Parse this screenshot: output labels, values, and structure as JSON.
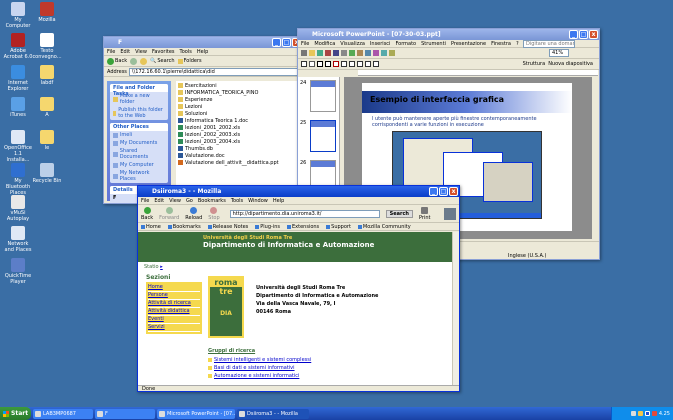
{
  "desktop": {
    "icons": [
      {
        "label": "My Computer",
        "color": "#c9d6f0"
      },
      {
        "label": "Mozilla",
        "color": "#c0392b"
      },
      {
        "label": "Adobe Acrobat 6.0",
        "color": "#b22222"
      },
      {
        "label": "Testo convegno...",
        "color": "#ffffff"
      },
      {
        "label": "Internet Explorer",
        "color": "#3b8de0"
      },
      {
        "label": "labdf",
        "color": "#f5d76e"
      },
      {
        "label": "iTunes",
        "color": "#5aa0e6"
      },
      {
        "label": "A",
        "color": "#f5d76e"
      },
      {
        "label": "OpenOffice 1.1 Installa...",
        "color": "#dfe8f5"
      },
      {
        "label": "le",
        "color": "#f5d76e"
      },
      {
        "label": "My Bluetooth Places",
        "color": "#2f6fd0"
      },
      {
        "label": "Recycle Bin",
        "color": "#bcd0e8"
      },
      {
        "label": "vMuSi Autoplay",
        "color": "#e8e8e8"
      },
      {
        "label": "Network and Places",
        "color": "#dfe8f5"
      },
      {
        "label": "QuickTime Player",
        "color": "#5c7ec8"
      }
    ]
  },
  "explorer": {
    "title": "F",
    "menu": [
      "File",
      "Edit",
      "View",
      "Favorites",
      "Tools",
      "Help"
    ],
    "toolbar": {
      "back": "Back",
      "search": "Search",
      "folders": "Folders"
    },
    "address_label": "Address",
    "address": "\\\\172.16.60.1\\pierre\\didattica\\did",
    "tasks": {
      "title": "File and Folder Tasks",
      "items": [
        "Make a new folder",
        "Publish this folder to the Web"
      ]
    },
    "places": {
      "title": "Other Places",
      "items": [
        "lmeli",
        "My Documents",
        "Shared Documents",
        "My Computer",
        "My Network Places"
      ]
    },
    "details": {
      "title": "Details",
      "name": "F",
      "type": "File Folder"
    },
    "files": [
      "Esercitazioni",
      "INFORMATICA_TEORICA_PINO",
      "Esperienze",
      "Lezioni",
      "Soluzioni",
      "Informatica Teorica 1.doc",
      "lezioni_2001_2002.xls",
      "lezioni_2002_2003.xls",
      "lezioni_2003_2004.xls",
      "Thumbs.db",
      "Valutazione.doc",
      "Valutazione dell_attivit__didattica.ppt"
    ]
  },
  "powerpoint": {
    "title": "Microsoft PowerPoint - [07-30-03.ppt]",
    "menu": [
      "File",
      "Modifica",
      "Visualizza",
      "Inserisci",
      "Formato",
      "Strumenti",
      "Presentazione",
      "Finestra",
      "?"
    ],
    "help_box": "Digitare una domanda",
    "zoom": "41%",
    "font_box": "Struttura",
    "layout_btn": "Nuova diapositiva",
    "slide_numbers": [
      "24",
      "25",
      "26",
      "27"
    ],
    "slide_title": "Esempio di interfaccia grafica",
    "slide_bullet": "l utente può mantenere aperte più finestre contemporaneamente corrispondenti a varie funzioni in esecuzione",
    "status": "Inglese (U.S.A.)"
  },
  "mozilla": {
    "title": "Dsiiroma3 - - Mozilla",
    "menu": [
      "File",
      "Edit",
      "View",
      "Go",
      "Bookmarks",
      "Tools",
      "Window",
      "Help"
    ],
    "nav": {
      "back": "Back",
      "forward": "Forward",
      "reload": "Reload",
      "stop": "Stop",
      "print": "Print",
      "search": "Search"
    },
    "url": "http://dipartimento.dia.uniroma3.it/",
    "personal_bar": [
      "Home",
      "Bookmarks",
      "Release Notes",
      "Plug-ins",
      "Extensions",
      "Support",
      "Mozilla Community"
    ],
    "site": {
      "university": "Università degli Studi Roma Tre",
      "department": "Dipartimento di Informatica e Automazione",
      "lang_label": "Statio",
      "sections_title": "Sezioni",
      "menu": [
        "Home",
        "Persone",
        "Attività di ricerca",
        "Attività didattica",
        "Eventi",
        "Servizi"
      ],
      "logo_line1": "roma",
      "logo_line2": "tre",
      "logo_dia": "DIA",
      "address": [
        "Università degli Studi Roma Tre",
        "Dipartimento di Informatica e Automazione",
        "Via della Vasca Navale, 79, I",
        "00146 Roma"
      ],
      "research_title": "Gruppi di ricerca",
      "research": [
        "Sistemi intelligenti e sistemi complessi",
        "Basi di dati e sistemi informativi",
        "Automazione e sistemi informatici"
      ]
    },
    "status": "Done"
  },
  "taskbar": {
    "start": "Start",
    "tasks": [
      "LAB3MP0687",
      "F",
      "Microsoft PowerPoint - [07...",
      "Dsiiroma3 - - Mozilla"
    ],
    "clock": "4.25"
  }
}
